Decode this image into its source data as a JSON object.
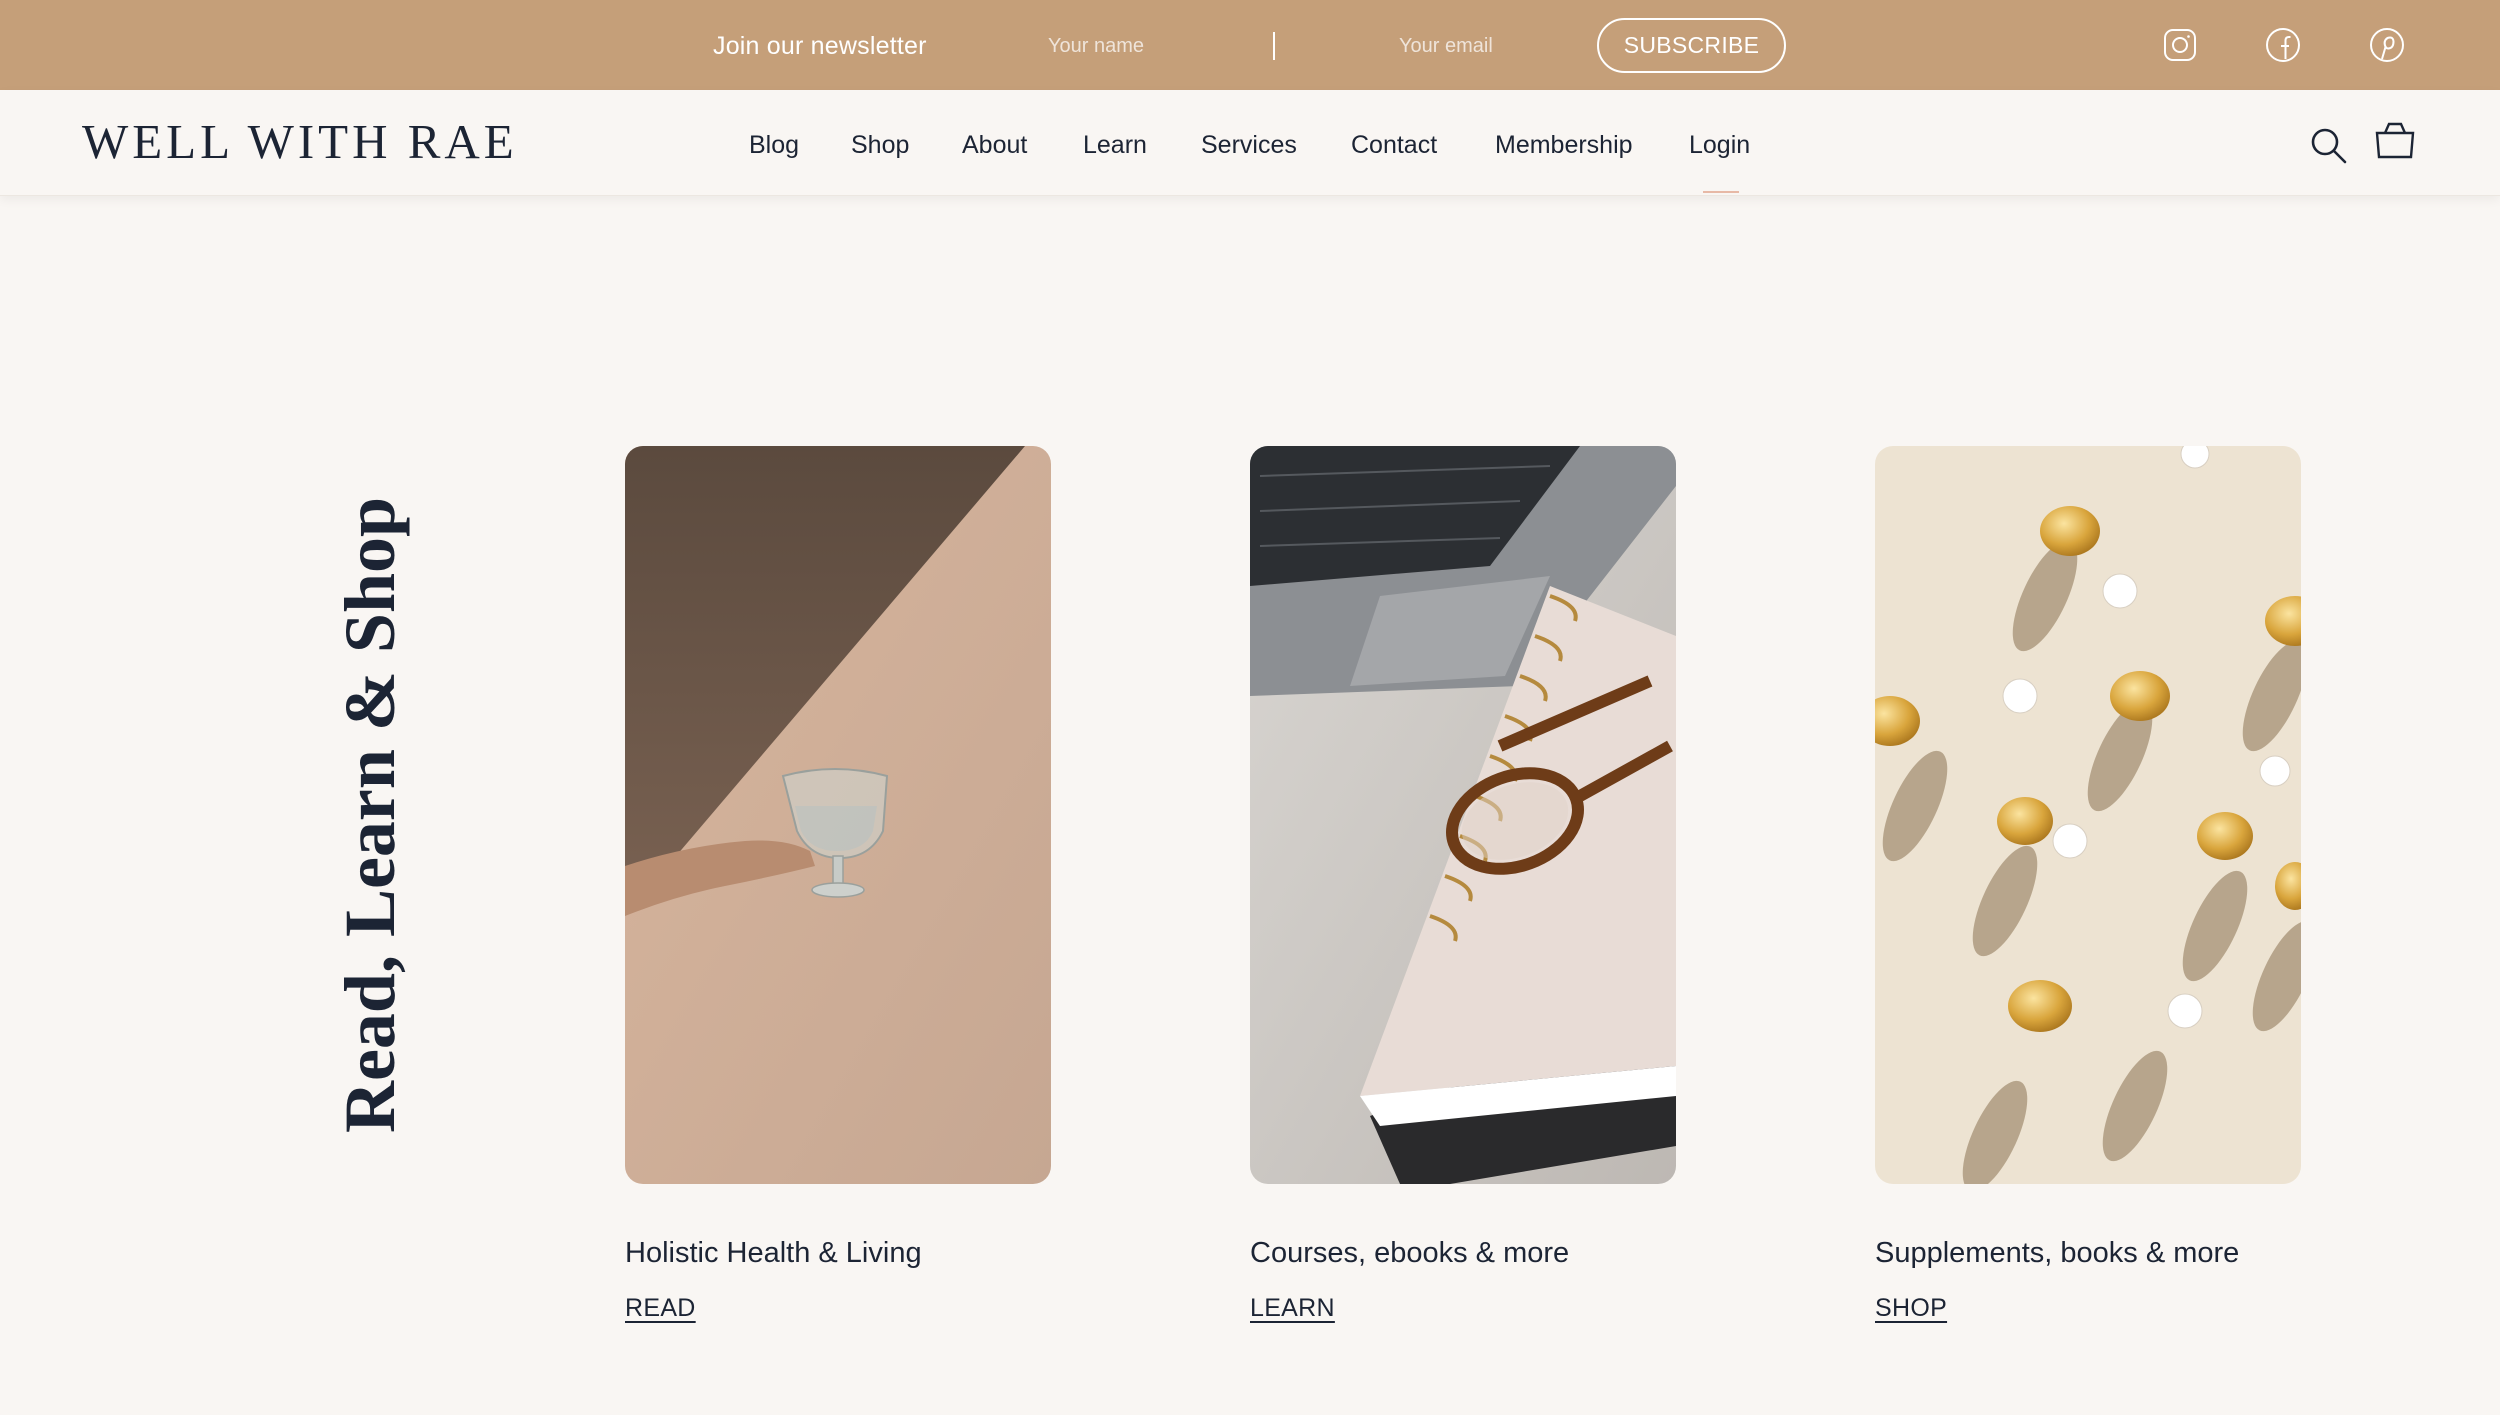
{
  "newsletter": {
    "title": "Join our newsletter",
    "name_placeholder": "Your name",
    "email_placeholder": "Your email",
    "subscribe_label": "SUBSCRIBE",
    "background_color": "#c59f79",
    "social": [
      {
        "icon": "instagram-icon"
      },
      {
        "icon": "facebook-icon"
      },
      {
        "icon": "pinterest-icon"
      }
    ]
  },
  "header": {
    "logo": "WELL WITH RAE",
    "nav": [
      {
        "label": "Blog"
      },
      {
        "label": "Shop"
      },
      {
        "label": "About"
      },
      {
        "label": "Learn"
      },
      {
        "label": "Services"
      },
      {
        "label": "Contact"
      },
      {
        "label": "Membership"
      },
      {
        "label": "Login"
      }
    ],
    "active_nav": "Login",
    "icons": [
      "search-icon",
      "shopping-bag-icon"
    ]
  },
  "section": {
    "title": "Read, Learn & Shop",
    "cards": [
      {
        "title": "Holistic Health & Living",
        "link": "READ",
        "image": "hand-holding-water-glass"
      },
      {
        "title": "Courses, ebooks & more",
        "link": "LEARN",
        "image": "laptop-notebook-glasses"
      },
      {
        "title": "Supplements, books & more",
        "link": "SHOP",
        "image": "supplement-capsules"
      }
    ]
  },
  "colors": {
    "page_background": "#f9f6f3",
    "text": "#1c2434",
    "accent": "#c59f79",
    "active_underline": "#e7b9a6"
  }
}
